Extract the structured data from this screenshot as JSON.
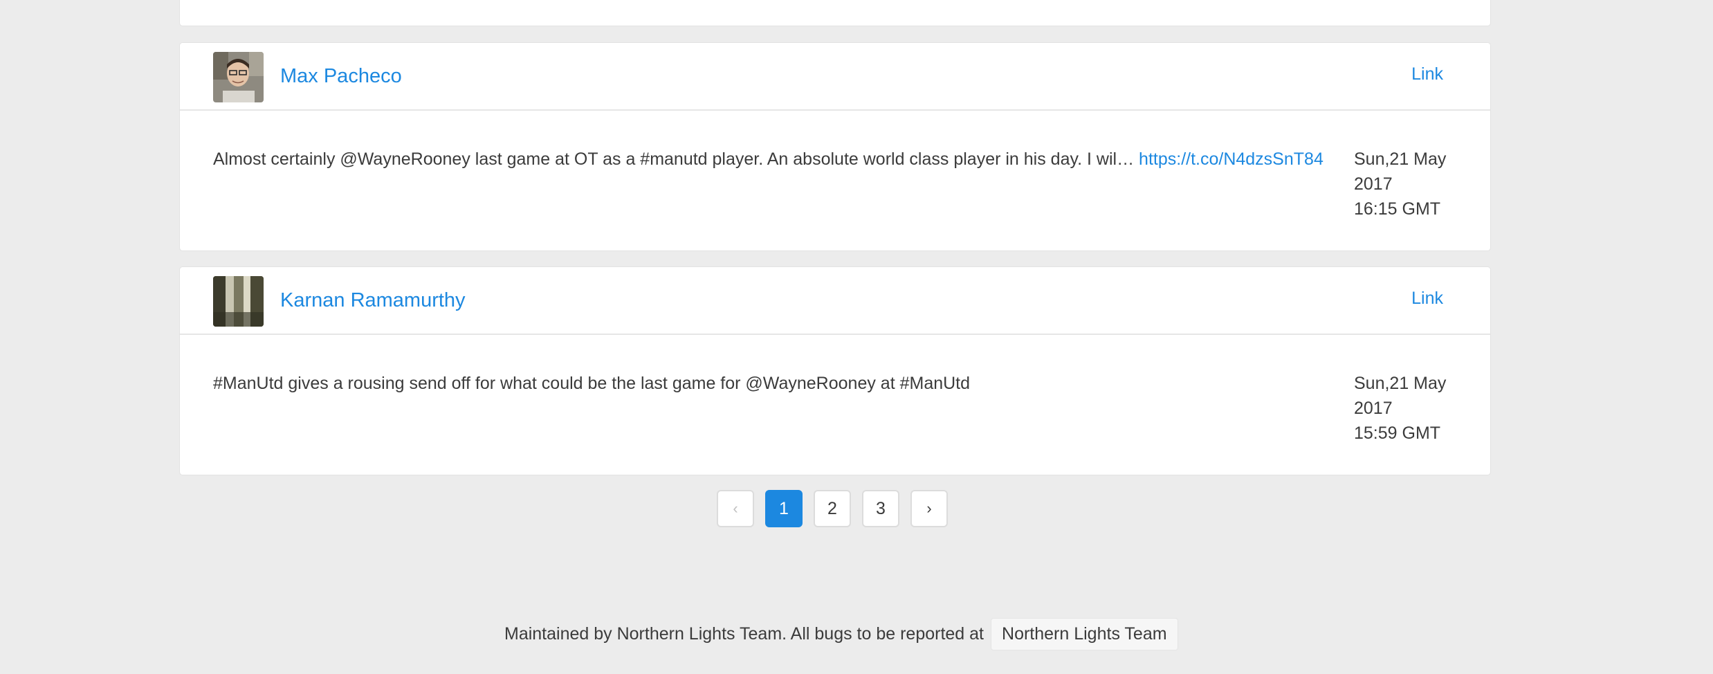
{
  "tweets": [
    {
      "author": "Max Pacheco",
      "link_label": "Link",
      "text": "Almost certainly @WayneRooney last game at OT as a #manutd player. An absolute world class player in his day. I wil…",
      "url": "https://t.co/N4dzsSnT84",
      "date_line1": "Sun,21 May",
      "date_line2": "2017",
      "time": "16:15 GMT",
      "avatar_icon": "person-avatar-icon"
    },
    {
      "author": "Karnan Ramamurthy",
      "link_label": "Link",
      "text": "#ManUtd gives a rousing send off for what could be the last game for @WayneRooney at #ManUtd",
      "url": "",
      "date_line1": "Sun,21 May",
      "date_line2": "2017",
      "time": "15:59 GMT",
      "avatar_icon": "photo-avatar-icon"
    }
  ],
  "pagination": {
    "prev_icon": "chevron-left-icon",
    "next_icon": "chevron-right-icon",
    "prev_glyph": "‹",
    "next_glyph": "›",
    "pages": [
      "1",
      "2",
      "3"
    ],
    "current": "1"
  },
  "footer": {
    "text": "Maintained by Northern Lights Team. All bugs to be reported at",
    "link": "Northern Lights Team"
  },
  "colors": {
    "accent": "#1c88e0",
    "background": "#ececec",
    "card": "#ffffff",
    "text": "#3b3b3b"
  }
}
